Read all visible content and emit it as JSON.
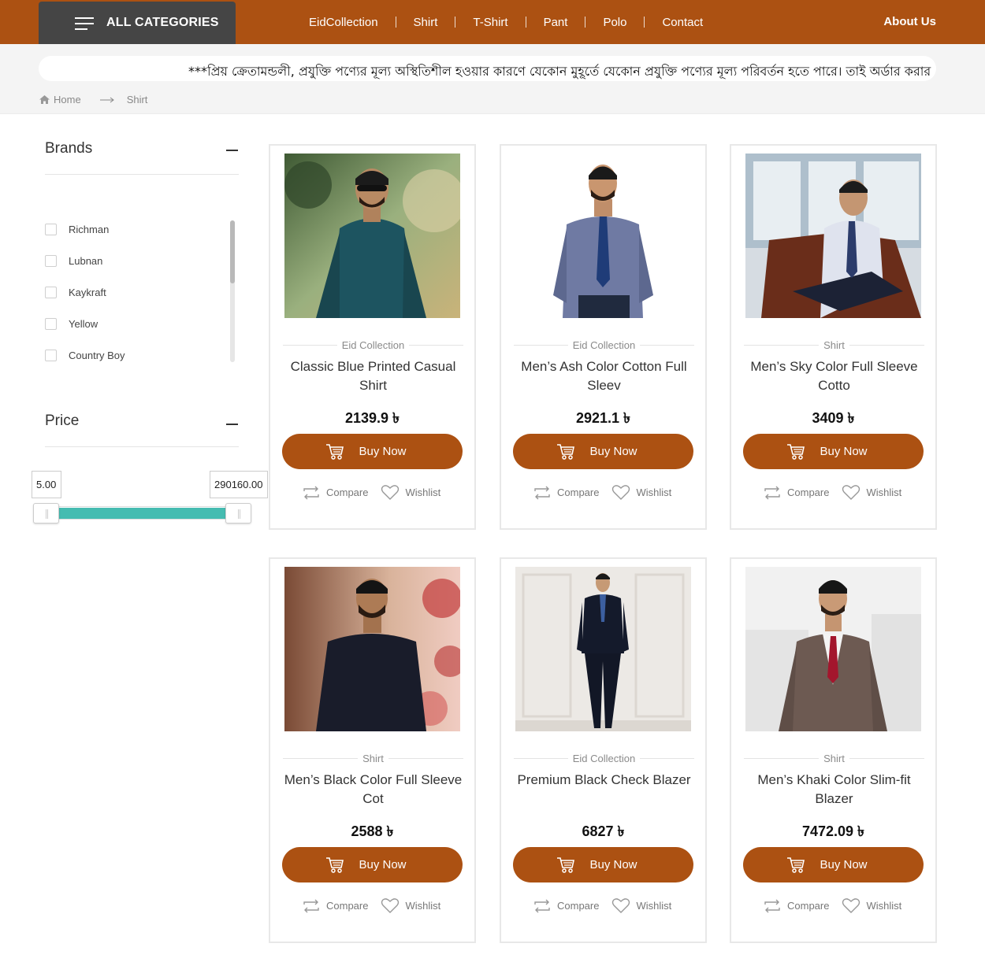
{
  "header": {
    "all_categories": "ALL CATEGORIES",
    "nav": [
      "EidCollection",
      "Shirt",
      "T-Shirt",
      "Pant",
      "Polo",
      "Contact"
    ],
    "about": "About Us"
  },
  "notice": "***প্রিয় ক্রেতামন্ডলী, প্রযুক্তি পণ্যের মূল্য অস্থিতিশীল হওয়ার কারণে যেকোন মুহূর্তে যেকোন প্রযুক্তি পণ্যের মূল্য পরিবর্তন হতে পারে। তাই অর্ডার করার",
  "breadcrumb": {
    "home": "Home",
    "current": "Shirt"
  },
  "sidebar": {
    "brands_title": "Brands",
    "brands": [
      "Richman",
      "Lubnan",
      "Kaykraft",
      "Yellow",
      "Country Boy"
    ],
    "price_title": "Price",
    "price_min": "5.00",
    "price_max": "290160.00"
  },
  "labels": {
    "buy": "Buy Now",
    "compare": "Compare",
    "wishlist": "Wishlist"
  },
  "colors": {
    "brand": "#ac5112",
    "dark": "#454545",
    "slider": "#45bcb1"
  },
  "products": [
    {
      "category": "Eid Collection",
      "title": "Classic Blue Printed Casual Shirt",
      "price": "2139.9 ৳"
    },
    {
      "category": "Eid Collection",
      "title": "Men’s Ash Color Cotton Full Sleev",
      "price": "2921.1 ৳"
    },
    {
      "category": "Shirt",
      "title": "Men’s Sky Color Full Sleeve Cotto",
      "price": "3409 ৳"
    },
    {
      "category": "Shirt",
      "title": "Men’s Black Color Full Sleeve Cot",
      "price": "2588 ৳"
    },
    {
      "category": "Eid Collection",
      "title": "Premium Black Check Blazer",
      "price": "6827 ৳"
    },
    {
      "category": "Shirt",
      "title": "Men’s Khaki Color Slim-fit Blazer",
      "price": "7472.09 ৳"
    }
  ]
}
